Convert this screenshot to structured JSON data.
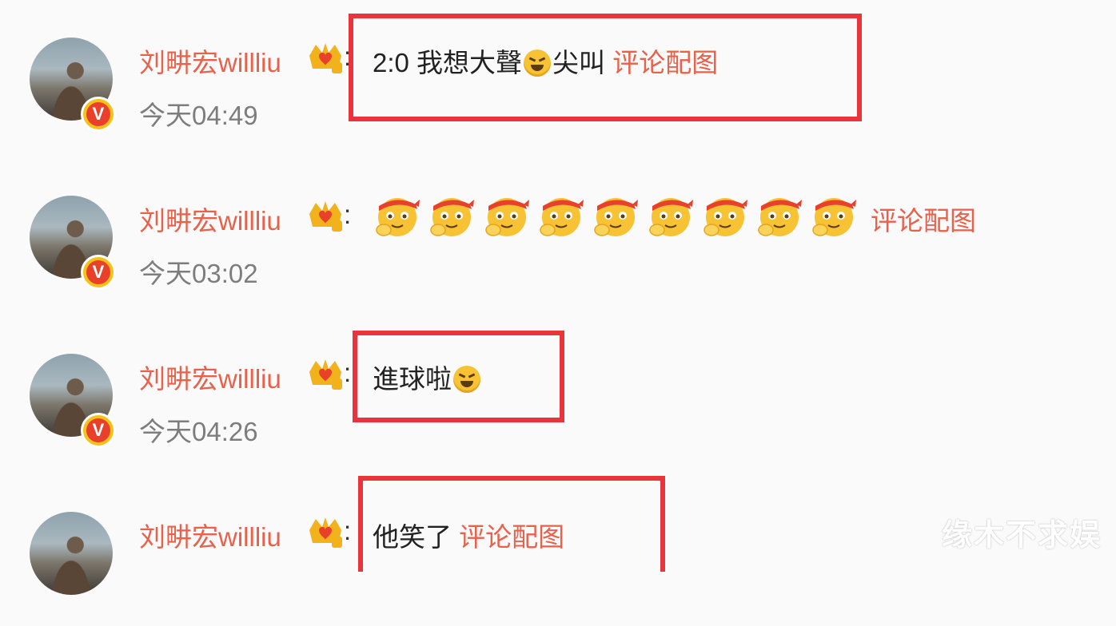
{
  "comments": [
    {
      "name": "刘畊宏willliu",
      "time": "今天04:49",
      "text": "2:0 我想大聲",
      "emoji": "laugh-emoji",
      "text_after": "尖叫",
      "link": "评论配图"
    },
    {
      "name": "刘畊宏willliu",
      "time": "今天03:02",
      "emoji": "cheer-emoji",
      "emoji_count": 9,
      "link": "评论配图"
    },
    {
      "name": "刘畊宏willliu",
      "time": "今天04:26",
      "text": "進球啦",
      "emoji": "laugh-emoji"
    },
    {
      "name": "刘畊宏willliu",
      "text": "他笑了",
      "link": "评论配图"
    }
  ],
  "badge_letter": "V",
  "watermark": "缘木不求娱",
  "colors": {
    "name": "#e8614a",
    "link": "#e8614a",
    "time": "#7d7d7d",
    "highlight_box": "#e8343a",
    "badge_bg": "#e8402a"
  }
}
